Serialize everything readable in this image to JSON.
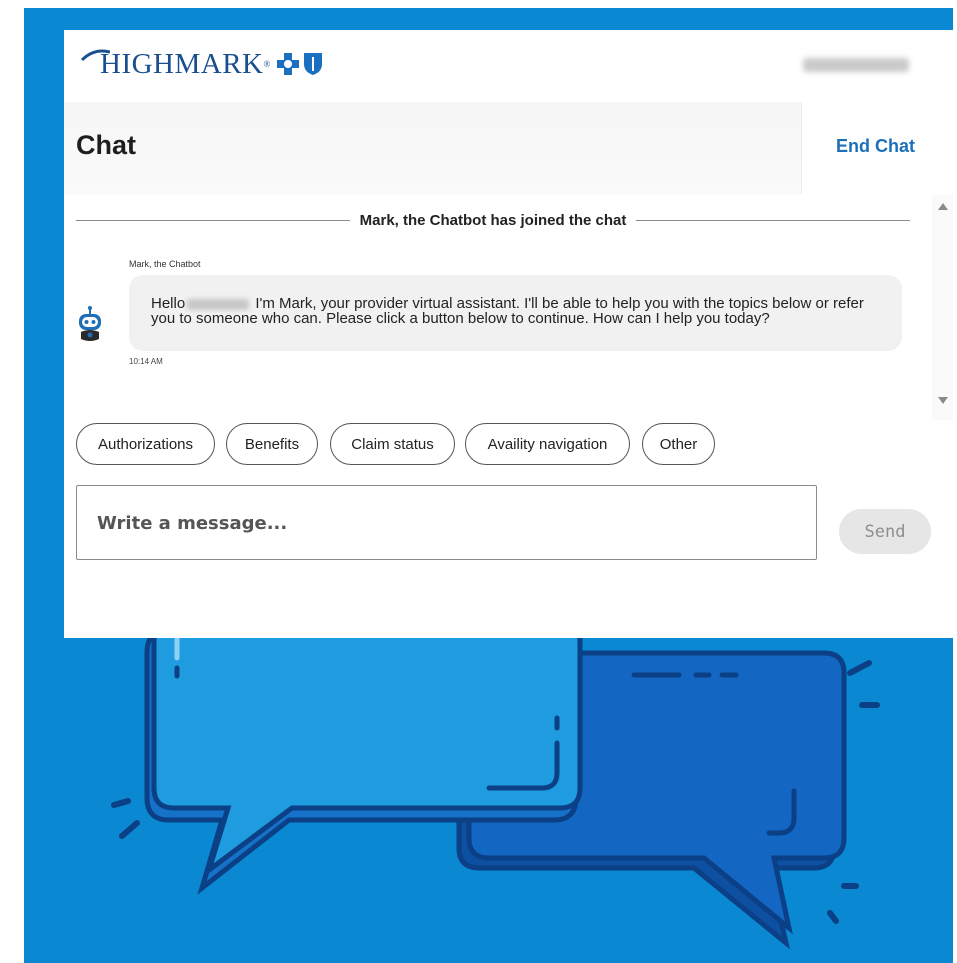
{
  "brand": {
    "name": "HIGHMARK",
    "trademark": "®"
  },
  "header": {
    "title": "Chat",
    "end_chat_label": "End Chat"
  },
  "conversation": {
    "joined_notice": "Mark, the Chatbot has joined the chat",
    "sender": "Mark, the Chatbot",
    "message_part1": "Hello",
    "message_part2": " I'm Mark, your provider virtual assistant. I'll be able to help you with the topics below or refer you to someone who can. Please click a button below to continue. How can I help you today?",
    "timestamp": "10:14 AM",
    "avatar_icon": "robot-icon"
  },
  "quick_replies": [
    {
      "label": "Authorizations"
    },
    {
      "label": "Benefits"
    },
    {
      "label": "Claim status"
    },
    {
      "label": "Availity navigation"
    },
    {
      "label": "Other"
    }
  ],
  "composer": {
    "placeholder": "Write a message...",
    "value": "",
    "send_label": "Send"
  },
  "colors": {
    "background": "#0a88d2",
    "brand_blue": "#1a4f8f",
    "link_blue": "#1d6fb8",
    "bubble_light": "#1f9be0",
    "bubble_dark": "#1366c2"
  }
}
